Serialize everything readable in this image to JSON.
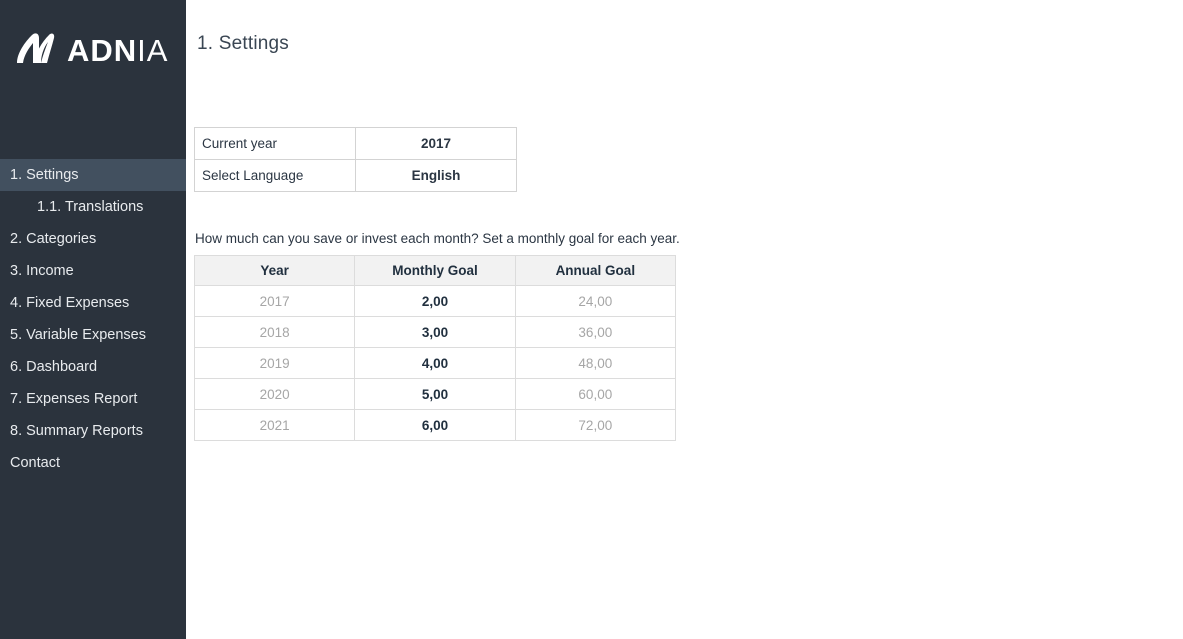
{
  "brand": {
    "logo_icon": "adnia-monogram-icon",
    "name_bold": "ADN",
    "name_light": "IA"
  },
  "colors": {
    "sidebar_bg": "#2b333d",
    "sidebar_active_bg": "#42505f",
    "sidebar_text": "#e8ebee",
    "page_bg": "#ffffff",
    "title_text": "#3a4653",
    "table_border": "#d3d3d3",
    "goals_header_bg": "#f2f2f2",
    "muted_text": "#a6a6a6",
    "strong_text": "#21303f"
  },
  "sidebar": {
    "items": [
      {
        "label": "1. Settings",
        "active": true,
        "sub": false
      },
      {
        "label": "1.1. Translations",
        "active": false,
        "sub": true
      },
      {
        "label": "2. Categories",
        "active": false,
        "sub": false
      },
      {
        "label": "3. Income",
        "active": false,
        "sub": false
      },
      {
        "label": "4. Fixed Expenses",
        "active": false,
        "sub": false
      },
      {
        "label": "5. Variable Expenses",
        "active": false,
        "sub": false
      },
      {
        "label": "6. Dashboard",
        "active": false,
        "sub": false
      },
      {
        "label": "7. Expenses Report",
        "active": false,
        "sub": false
      },
      {
        "label": "8. Summary Reports",
        "active": false,
        "sub": false
      },
      {
        "label": "Contact",
        "active": false,
        "sub": false
      }
    ]
  },
  "main": {
    "page_title": "1. Settings",
    "settings": {
      "rows": [
        {
          "label": "Current year",
          "value": "2017"
        },
        {
          "label": "Select Language",
          "value": "English"
        }
      ]
    },
    "goals": {
      "description": "How much can you save or invest each month? Set a monthly goal for each year.",
      "columns": [
        "Year",
        "Monthly Goal",
        "Annual Goal"
      ],
      "rows": [
        {
          "year": "2017",
          "monthly": "2,00",
          "annual": "24,00"
        },
        {
          "year": "2018",
          "monthly": "3,00",
          "annual": "36,00"
        },
        {
          "year": "2019",
          "monthly": "4,00",
          "annual": "48,00"
        },
        {
          "year": "2020",
          "monthly": "5,00",
          "annual": "60,00"
        },
        {
          "year": "2021",
          "monthly": "6,00",
          "annual": "72,00"
        }
      ]
    }
  }
}
